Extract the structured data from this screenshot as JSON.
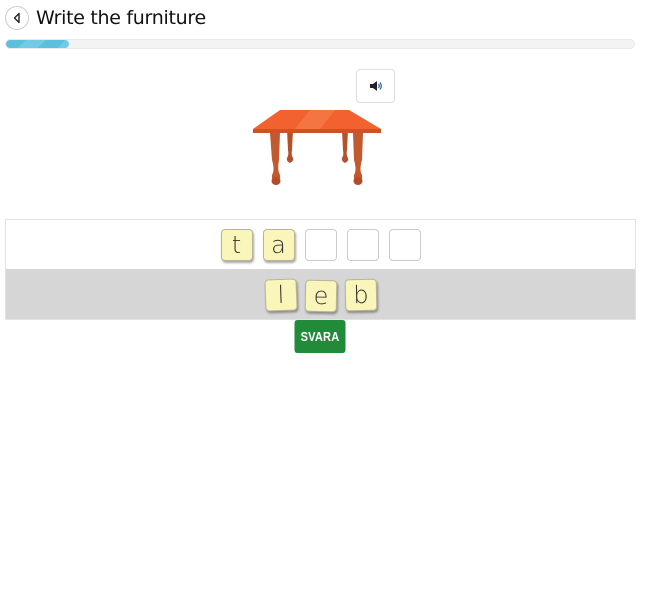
{
  "header": {
    "back_icon": "chevron-left-circle-icon",
    "title": "Write the furniture"
  },
  "progress": {
    "percent": 10,
    "colors": {
      "fill": "#5bc0de",
      "track": "#f3f3f3"
    }
  },
  "prompt": {
    "sound_icon": "speaker-volume-icon",
    "image_subject": "orange wooden table"
  },
  "answer": {
    "slots": [
      "t",
      "a",
      "",
      "",
      ""
    ]
  },
  "tray": {
    "tiles": [
      "l",
      "e",
      "b"
    ]
  },
  "submit": {
    "label": "SVARA",
    "color": "#228b3a"
  }
}
